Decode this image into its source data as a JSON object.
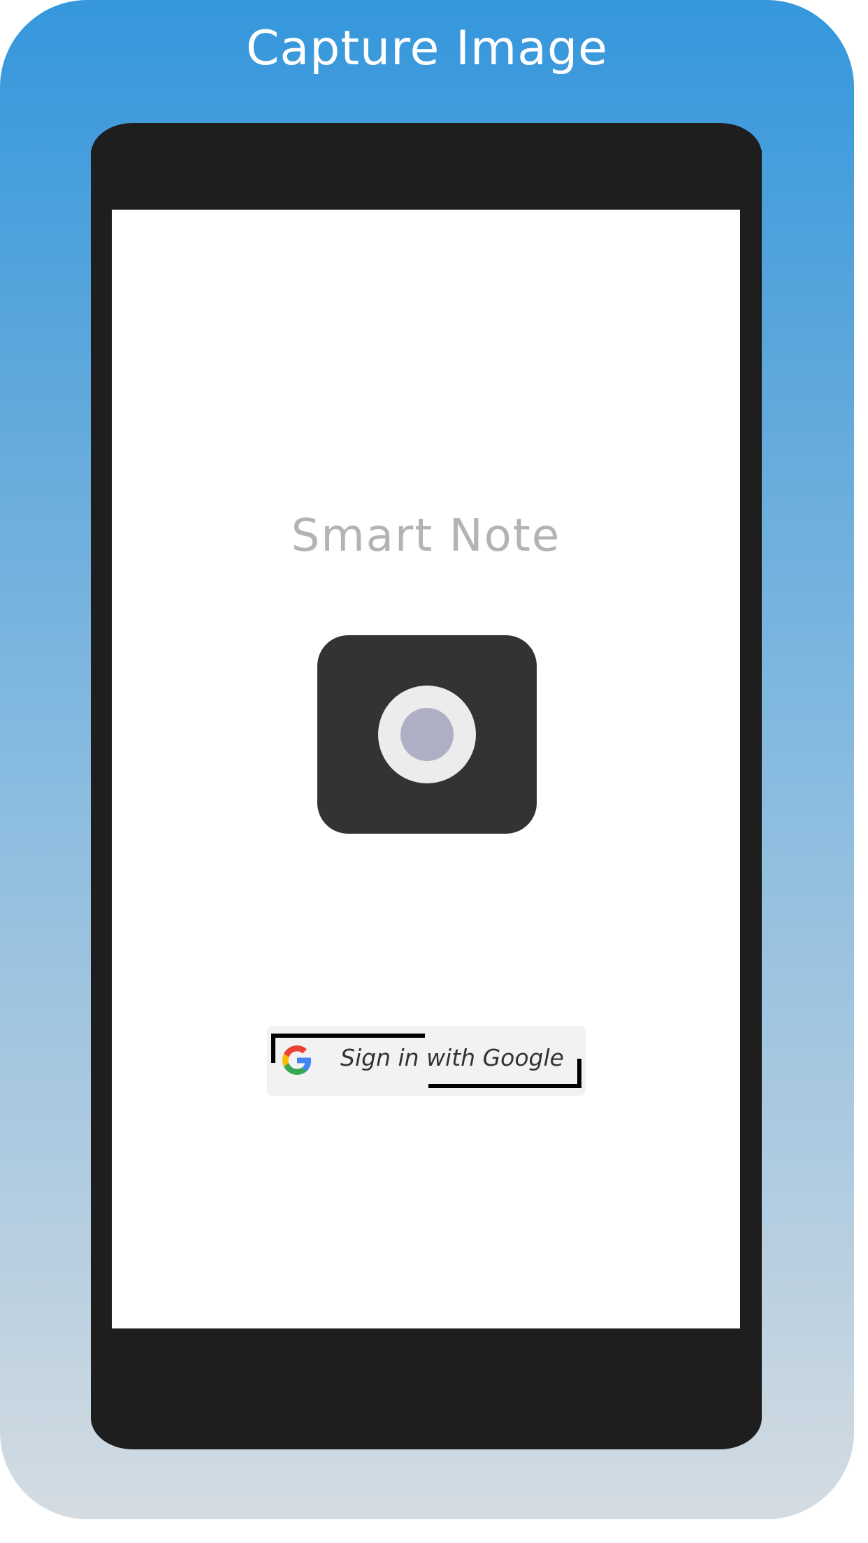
{
  "header": {
    "title": "Capture Image"
  },
  "app": {
    "title": "Smart Note",
    "camera_icon": "camera-icon",
    "google_button": {
      "label": "Sign in with Google",
      "icon": "google-g-icon"
    }
  },
  "colors": {
    "background_top": "#3597dc",
    "background_bottom": "#d4dce2",
    "phone_frame": "#1e1e1e",
    "camera_button": "#333333",
    "lens_ring": "#ececec",
    "lens_center": "#aeaec5",
    "app_title": "#b3b3b3"
  }
}
